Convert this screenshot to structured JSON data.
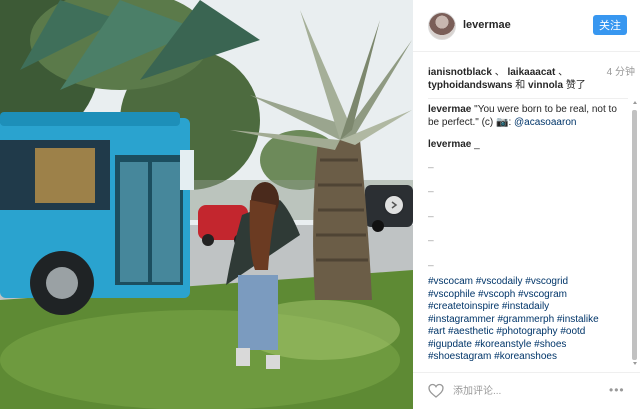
{
  "post": {
    "photo": {
      "description_icon": "bus-and-palm-tree-photo",
      "next_icon": "chevron-right-icon"
    },
    "header": {
      "username": "levermae",
      "follow_label": "关注"
    },
    "likes": {
      "user1": "ianisnotblack",
      "sep1": "、",
      "user2": "laikaaacat",
      "sep2": "、",
      "user3": "typhoidandswans",
      "conj": "和",
      "user4": "vinnola",
      "suffix": "赞了",
      "time": "4 分钟"
    },
    "caption": {
      "username": "levermae",
      "text": "\"You were born to be real, not to be perfect.\" (c) 📷: ",
      "mention": "@acasoaaron"
    },
    "comment": {
      "username": "levermae",
      "first": "_",
      "dashes": [
        "_",
        "_",
        "_",
        "_",
        "_"
      ]
    },
    "hashtags": [
      "#vscocam #vscodaily #vscogrid",
      "#vscophile #vscoph #vscogram",
      "#createtoinspire #instadaily",
      "#instagrammer #grammerph #instalike",
      "#art #aesthetic #photography #ootd",
      "#igupdate #koreanstyle #shoes",
      "#shoestagram #koreanshoes"
    ],
    "footer": {
      "comment_placeholder": "添加评论...",
      "more_label": "•••"
    },
    "colors": {
      "follow_button": "#3897f0",
      "link": "#003569",
      "bus": "#2aa3cf"
    }
  }
}
